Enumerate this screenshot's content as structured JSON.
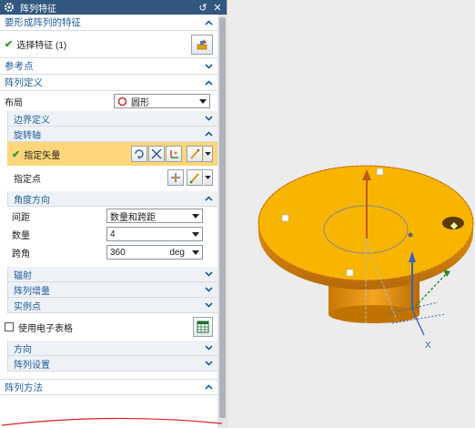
{
  "dialog": {
    "title": "阵列特征"
  },
  "sections": {
    "feature": {
      "label": "要形成阵列的特征",
      "select_label": "选择特征 (1)"
    },
    "ref_point": {
      "label": "参考点"
    },
    "array_def": {
      "label": "阵列定义",
      "layout_label": "布局",
      "layout_value": "圆形",
      "boundary": {
        "label": "边界定义"
      },
      "axis": {
        "label": "旋转轴",
        "vector_label": "指定矢量",
        "point_label": "指定点"
      },
      "angle": {
        "label": "角度方向",
        "spacing_label": "间距",
        "spacing_value": "数量和跨距",
        "count_label": "数量",
        "count_value": "4",
        "span_label": "跨角",
        "span_value": "360",
        "span_unit": "deg"
      },
      "radial": {
        "label": "辐射"
      },
      "increment": {
        "label": "阵列增量"
      },
      "instance": {
        "label": "实例点"
      },
      "spreadsheet_label": "使用电子表格",
      "direction": {
        "label": "方向"
      },
      "settings": {
        "label": "阵列设置"
      }
    },
    "method": {
      "label": "阵列方法"
    }
  },
  "viewport": {
    "axis_label": "X"
  },
  "colors": {
    "title_bar": "#31577f",
    "section_text": "#1f5c9c",
    "highlight": "#ffd67a",
    "part": "#f7b500"
  }
}
